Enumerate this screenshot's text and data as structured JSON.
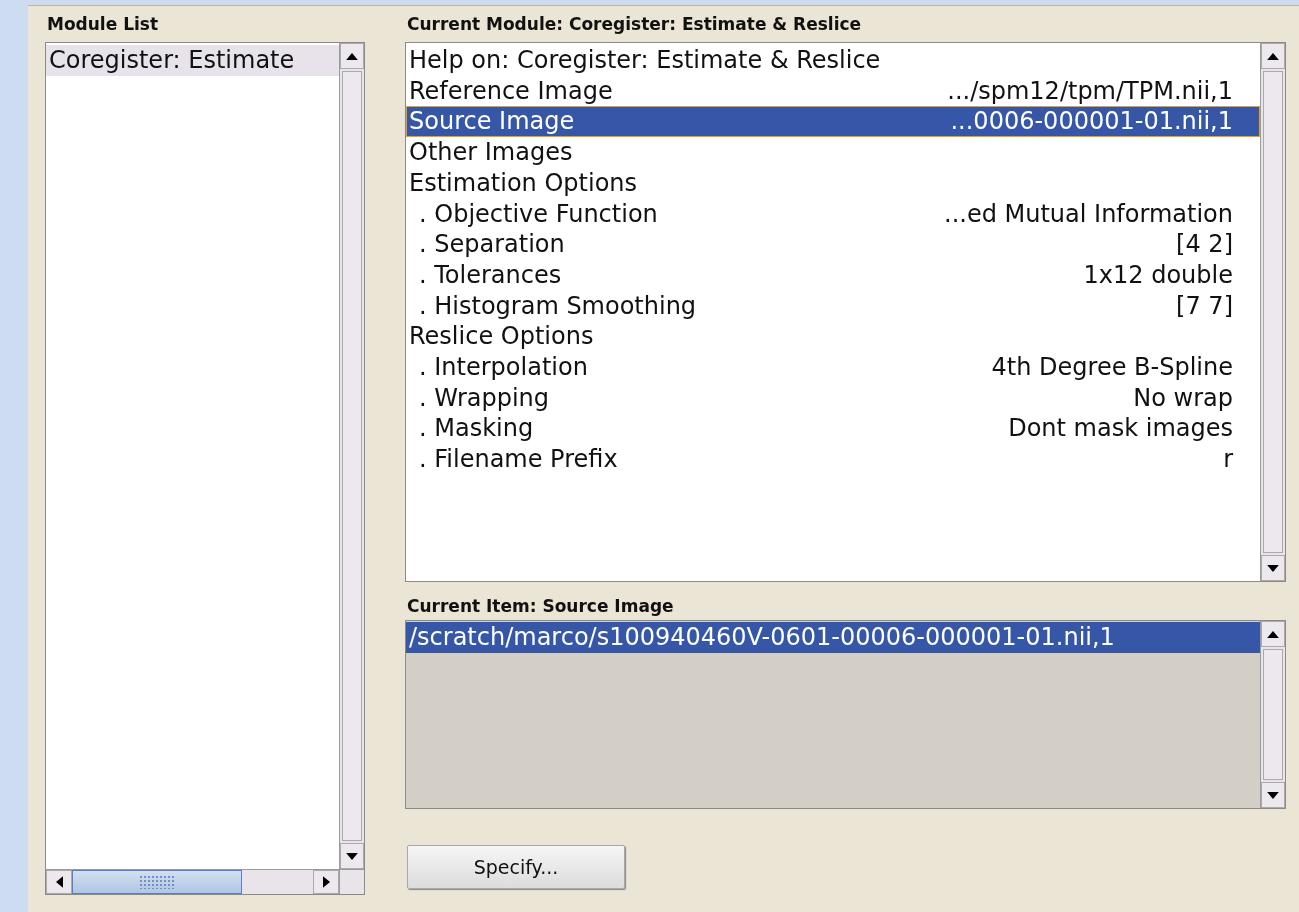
{
  "module_list": {
    "title": "Module List",
    "items": [
      {
        "label": "Coregister: Estimate",
        "selected": true
      }
    ]
  },
  "current_module": {
    "title": "Current Module: Coregister: Estimate & Reslice",
    "rows": [
      {
        "label": "Help on: Coregister: Estimate & Reslice",
        "selected": false
      },
      {
        "label": "Reference Image",
        "value": ".../spm12/tpm/TPM.nii,1",
        "selected": false
      },
      {
        "label": "Source Image",
        "value": "...0006-000001-01.nii,1",
        "selected": true
      },
      {
        "label": "Other Images",
        "selected": false
      },
      {
        "label": "Estimation Options",
        "selected": false,
        "children": [
          {
            "label": ". Objective Function",
            "value": "...ed Mutual Information",
            "selected": false
          },
          {
            "label": ". Separation",
            "value": "[4 2]",
            "selected": false
          },
          {
            "label": ". Tolerances",
            "value": "1x12 double",
            "selected": false
          },
          {
            "label": ". Histogram Smoothing",
            "value": "[7 7]",
            "selected": false
          }
        ]
      },
      {
        "label": "Reslice Options",
        "selected": false,
        "children": [
          {
            "label": ". Interpolation",
            "value": "4th Degree B-Spline",
            "selected": false
          },
          {
            "label": ". Wrapping",
            "value": "No wrap",
            "selected": false
          },
          {
            "label": ". Masking",
            "value": "Dont mask images",
            "selected": false
          },
          {
            "label": ". Filename Prefix",
            "value": "r",
            "selected": false
          }
        ]
      }
    ]
  },
  "current_item": {
    "title": "Current Item: Source Image",
    "items": [
      {
        "label": "/scratch/marco/s100940460V-0601-00006-000001-01.nii,1",
        "selected": true
      }
    ]
  },
  "buttons": [
    {
      "label": "Specify..."
    }
  ]
}
